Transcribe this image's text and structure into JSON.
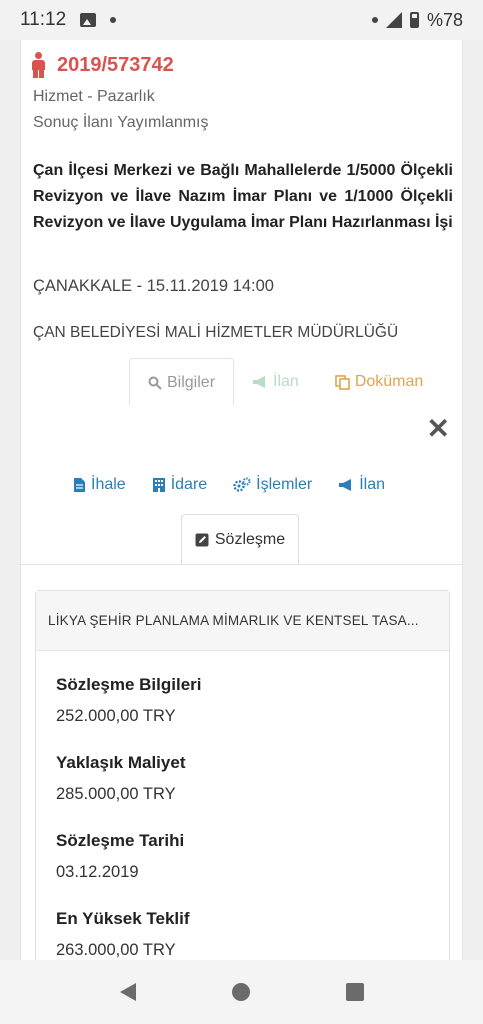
{
  "status": {
    "time": "11:12",
    "battery": "%78"
  },
  "header": {
    "ref_no": "2019/573742",
    "type": "Hizmet - Pazarlık",
    "state": "Sonuç İlanı Yayımlanmış",
    "title": "Çan İlçesi Merkezi ve Bağlı Mahallelerde 1/5000 Ölçekli Revizyon ve İlave Nazım İmar Planı ve 1/1000 Ölçekli Revizyon ve İlave Uygulama İmar Planı Hazırlanması İşi",
    "location_date": "ÇANAKKALE - 15.11.2019 14:00",
    "authority": "ÇAN BELEDİYESİ MALİ HİZMETLER MÜDÜRLÜĞÜ"
  },
  "tabs_top": [
    {
      "label": "Bilgiler",
      "icon": "search-icon"
    },
    {
      "label": "İlan",
      "icon": "megaphone-icon"
    },
    {
      "label": "Doküman",
      "icon": "copy-icon"
    }
  ],
  "tabs_sub": [
    {
      "label": "İhale",
      "icon": "document-icon"
    },
    {
      "label": "İdare",
      "icon": "building-icon"
    },
    {
      "label": "İşlemler",
      "icon": "gears-icon"
    },
    {
      "label": "İlan",
      "icon": "megaphone-icon"
    }
  ],
  "contract_tab": {
    "label": "Sözleşme",
    "icon": "edit-icon"
  },
  "panel": {
    "company": "LİKYA ŞEHİR PLANLAMA MİMARLIK VE KENTSEL TASA...",
    "fields": [
      {
        "label": "Sözleşme Bilgileri",
        "value": "252.000,00 TRY"
      },
      {
        "label": "Yaklaşık Maliyet",
        "value": "285.000,00 TRY"
      },
      {
        "label": "Sözleşme Tarihi",
        "value": "03.12.2019"
      },
      {
        "label": "En Yüksek Teklif",
        "value": "263.000,00 TRY"
      }
    ]
  },
  "colors": {
    "accent_red": "#d9534f",
    "link_blue": "#2a7fb8",
    "doc_orange": "#e0a54a"
  }
}
